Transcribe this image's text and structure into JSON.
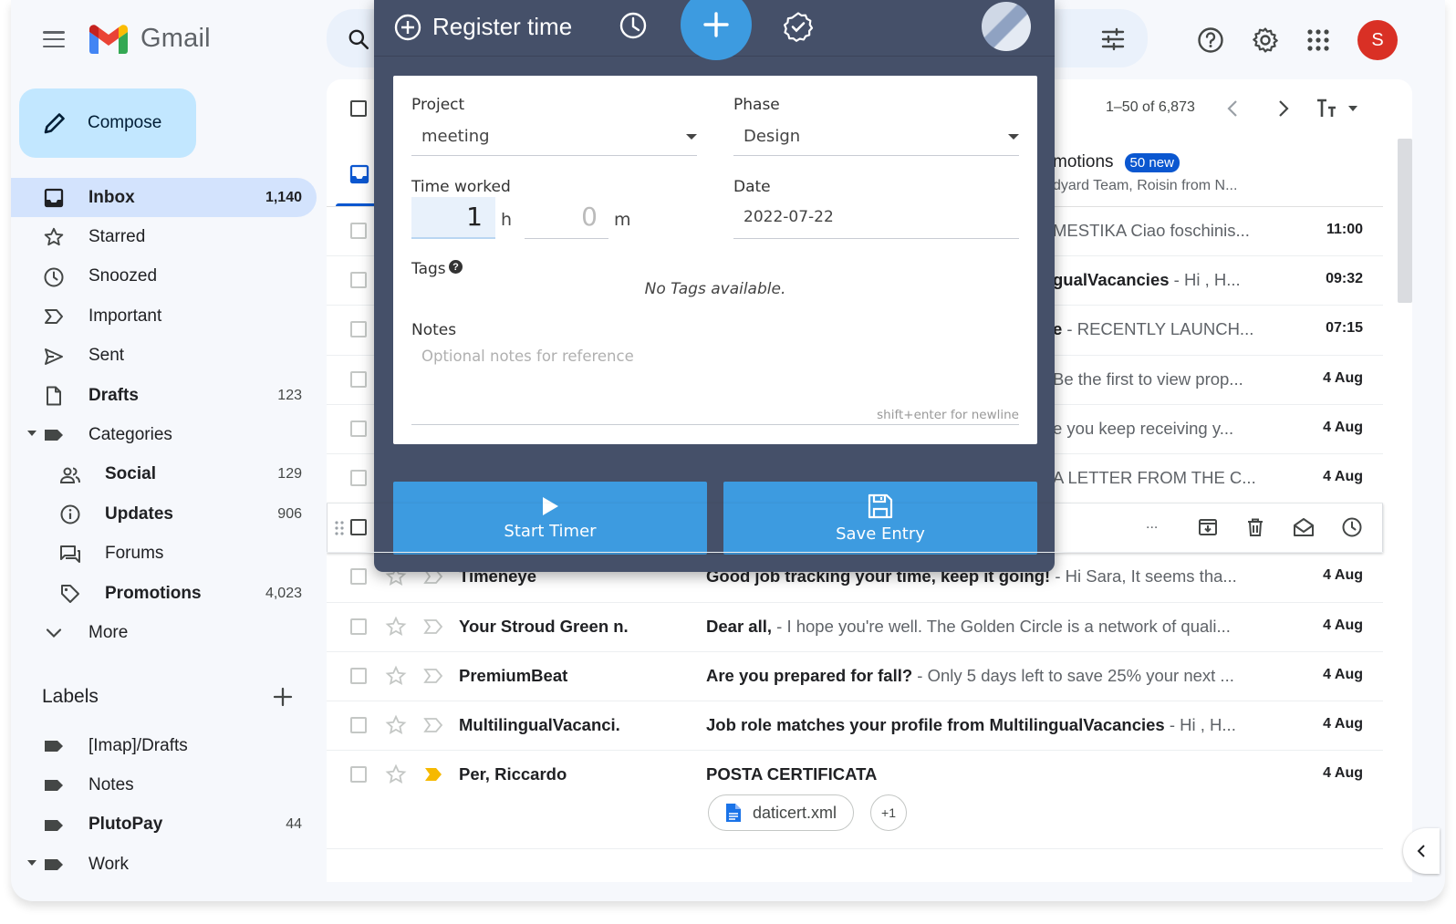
{
  "app": {
    "name": "Gmail",
    "avatar_letter": "S"
  },
  "compose_label": "Compose",
  "nav": [
    {
      "label": "Inbox",
      "count": "1,140",
      "icon": "inbox-icon",
      "active": true
    },
    {
      "label": "Starred",
      "count": "",
      "icon": "star-icon"
    },
    {
      "label": "Snoozed",
      "count": "",
      "icon": "clock-icon"
    },
    {
      "label": "Important",
      "count": "",
      "icon": "important-icon"
    },
    {
      "label": "Sent",
      "count": "",
      "icon": "send-icon"
    },
    {
      "label": "Drafts",
      "count": "123",
      "icon": "draft-icon",
      "bold": true
    },
    {
      "label": "Categories",
      "count": "",
      "icon": "label-icon"
    },
    {
      "label": "Social",
      "count": "129",
      "icon": "people-icon",
      "bold": true
    },
    {
      "label": "Updates",
      "count": "906",
      "icon": "info-icon",
      "bold": true
    },
    {
      "label": "Forums",
      "count": "",
      "icon": "forum-icon"
    },
    {
      "label": "Promotions",
      "count": "4,023",
      "icon": "tag-icon",
      "bold": true
    },
    {
      "label": "More",
      "count": "",
      "icon": "chevron-down-icon"
    }
  ],
  "labels_section": {
    "title": "Labels",
    "items": [
      {
        "label": "[Imap]/Drafts",
        "count": ""
      },
      {
        "label": "Notes",
        "count": ""
      },
      {
        "label": "PlutoPay",
        "count": "44"
      },
      {
        "label": "Work",
        "count": ""
      }
    ]
  },
  "pager": {
    "range": "1–50 of 6,873"
  },
  "tabs": {
    "promotions_label": "motions",
    "promotions_badge": "50 new",
    "promotions_sub": "dyard Team, Roisin from N..."
  },
  "emails": [
    {
      "sender": "",
      "subject": "",
      "snippet": "MESTIKA Ciao foschinis...",
      "time": "11:00"
    },
    {
      "sender": "",
      "subject": "gualVacancies",
      "snippet": " - Hi , H...",
      "time": "09:32"
    },
    {
      "sender": "",
      "subject": "e",
      "snippet": " - RECENTLY LAUNCH...",
      "time": "07:15"
    },
    {
      "sender": "",
      "subject": "",
      "snippet": "Be the first to view prop...",
      "time": "4 Aug"
    },
    {
      "sender": "",
      "subject": "",
      "snippet": "e you keep receiving y...",
      "time": "4 Aug"
    },
    {
      "sender": "",
      "subject": "",
      "snippet": "A LETTER FROM THE C...",
      "time": "4 Aug"
    },
    {
      "sender": "",
      "subject": "",
      "snippet": "",
      "time": "",
      "dots": "..."
    },
    {
      "sender": "Timeneye",
      "subject": "Good job tracking your time, keep it going!",
      "snippet": " - Hi Sara, It seems tha...",
      "time": "4 Aug"
    },
    {
      "sender": "Your Stroud Green n.",
      "subject": "Dear all,",
      "snippet": " - I hope you're well. The Golden Circle is a network of quali...",
      "time": "4 Aug"
    },
    {
      "sender": "PremiumBeat",
      "subject": "Are you prepared for fall?",
      "snippet": " - Only 5 days left to save 25% your next ...",
      "time": "4 Aug"
    },
    {
      "sender": "MultilingualVacanci.",
      "subject": "Job role matches your profile from MultilingualVacancies",
      "snippet": " - Hi , H...",
      "time": "4 Aug"
    },
    {
      "sender": "Per, Riccardo",
      "subject": "POSTA CERTIFICATA",
      "snippet": "",
      "time": "4 Aug",
      "attachment": "daticert.xml",
      "attachment_more": "+1"
    }
  ],
  "timeneye": {
    "title": "Register time",
    "project_label": "Project",
    "project_value": "meeting",
    "phase_label": "Phase",
    "phase_value": "Design",
    "time_label": "Time worked",
    "hours": "1",
    "hours_unit": "h",
    "minutes": "0",
    "minutes_unit": "m",
    "date_label": "Date",
    "date_value": "2022-07-22",
    "tags_label": "Tags",
    "tags_help": "?",
    "no_tags": "No Tags available.",
    "notes_label": "Notes",
    "notes_placeholder": "Optional notes for reference",
    "notes_hint": "shift+enter for newline",
    "start_label": "Start Timer",
    "save_label": "Save Entry"
  },
  "colors": {
    "accent": "#3d9be0",
    "panel": "#455069",
    "gmail_active": "#d3e3fd",
    "compose": "#c2e7ff",
    "avatar": "#d93025"
  }
}
